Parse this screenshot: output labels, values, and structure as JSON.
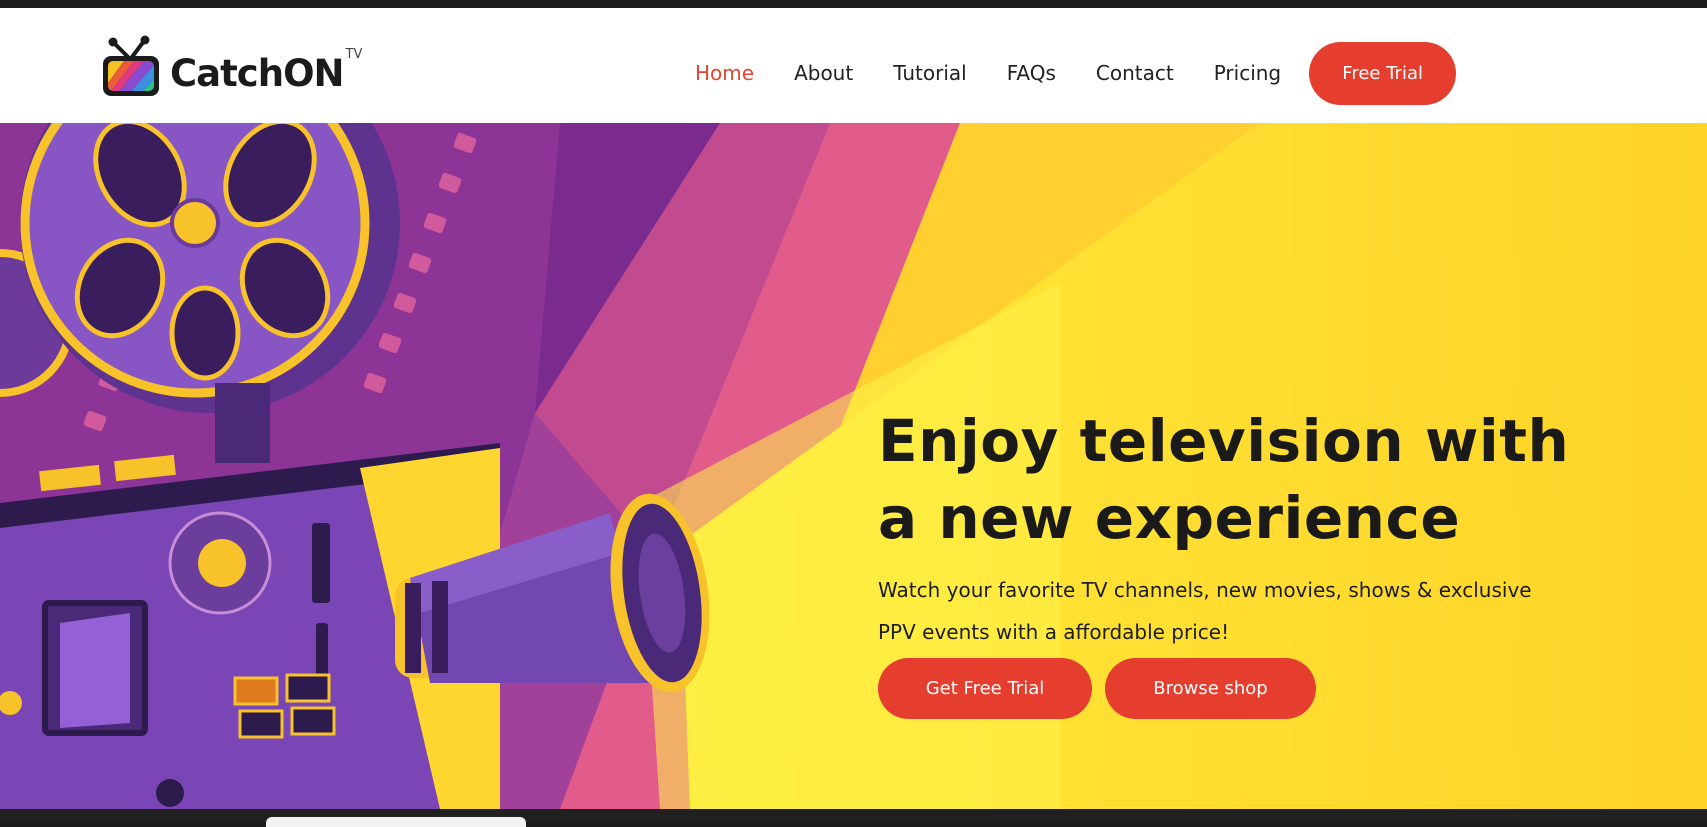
{
  "brand": {
    "name": "CatchON",
    "suffix": "TV"
  },
  "nav": {
    "items": [
      {
        "label": "Home",
        "active": true
      },
      {
        "label": "About",
        "active": false
      },
      {
        "label": "Tutorial",
        "active": false
      },
      {
        "label": "FAQs",
        "active": false
      },
      {
        "label": "Contact",
        "active": false
      },
      {
        "label": "Pricing",
        "active": false
      }
    ],
    "cta": "Free Trial"
  },
  "hero": {
    "title_line1": "Enjoy television with",
    "title_line2": "a new experience",
    "subtitle": "Watch your favorite TV channels, new movies, shows & exclusive PPV events with a affordable price!",
    "primary_button": "Get Free Trial",
    "secondary_button": "Browse shop"
  },
  "colors": {
    "accent": "#e53e2e",
    "nav_active": "#e64431",
    "hero_yellow": "#fff24a",
    "purple": "#7a3fa0",
    "pink": "#e85a8c"
  }
}
